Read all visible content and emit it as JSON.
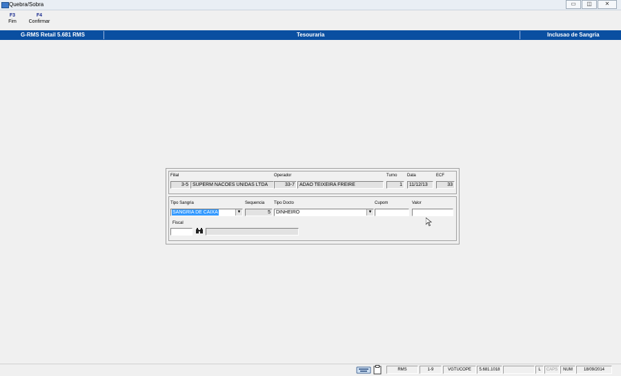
{
  "window": {
    "title": "Quebra/Sobra",
    "minimize": "▭",
    "restore": "◫",
    "close": "✕"
  },
  "toolbar": [
    {
      "key": "F3",
      "label": "Fim"
    },
    {
      "key": "F4",
      "label": "Confirmar"
    }
  ],
  "header": {
    "app": "G-RMS Retail 5.681 RMS",
    "module": "Tesouraria",
    "screen": "Inclusao de Sangria"
  },
  "form": {
    "filial": {
      "label": "Filial",
      "code": "3-5",
      "name": "SUPERM NACOES UNIDAS LTDA"
    },
    "operador": {
      "label": "Operador",
      "code": "33-7",
      "name": "ADAO TEIXEIRA FREIRE"
    },
    "turno": {
      "label": "Turno",
      "value": "1"
    },
    "data": {
      "label": "Data",
      "value": "11/12/13"
    },
    "ecf": {
      "label": "ECF",
      "value": "33"
    },
    "tipo_sangria": {
      "label": "Tipo Sangria",
      "value": "SANGRIA DE CAIXA"
    },
    "sequencia": {
      "label": "Sequencia",
      "value": "5"
    },
    "tipo_docto": {
      "label": "Tipo Docto",
      "value": "DINHEIRO"
    },
    "cupom": {
      "label": "Cupom",
      "value": ""
    },
    "valor": {
      "label": "Valor",
      "value": ""
    },
    "fiscal": {
      "label": "Fiscal",
      "value": "",
      "search_icon": "binoculars-icon",
      "name": ""
    }
  },
  "statusbar": {
    "system": "RMS",
    "version_code": "1-9",
    "program": "VGTUCOPE",
    "build": "5.681.1018",
    "blank": "",
    "l": "L",
    "caps": "CAPS",
    "num": "NUM",
    "date": "18/09/2014"
  }
}
